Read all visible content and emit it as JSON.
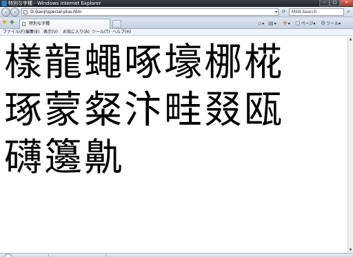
{
  "window": {
    "title": "特別な字種 - Windows Internet Explorer"
  },
  "address_bar": {
    "url": "D:\\kanji\\special-plus.htm",
    "search_placeholder": "MSN Search"
  },
  "tabs": [
    {
      "label": "特別な字種"
    }
  ],
  "command_bar": {
    "page_label": "ページ",
    "tools_label": "ツール"
  },
  "menu": {
    "items": [
      "ファイル(F)",
      "編集(E)",
      "表示(V)",
      "お気に入り(A)",
      "ツール(T)",
      "ヘルプ(H)"
    ]
  },
  "content": {
    "lines": [
      "樣龍蠅啄壕梛椛",
      "琢蒙粲汴畦叕瓯",
      "礴籩鼽"
    ]
  }
}
